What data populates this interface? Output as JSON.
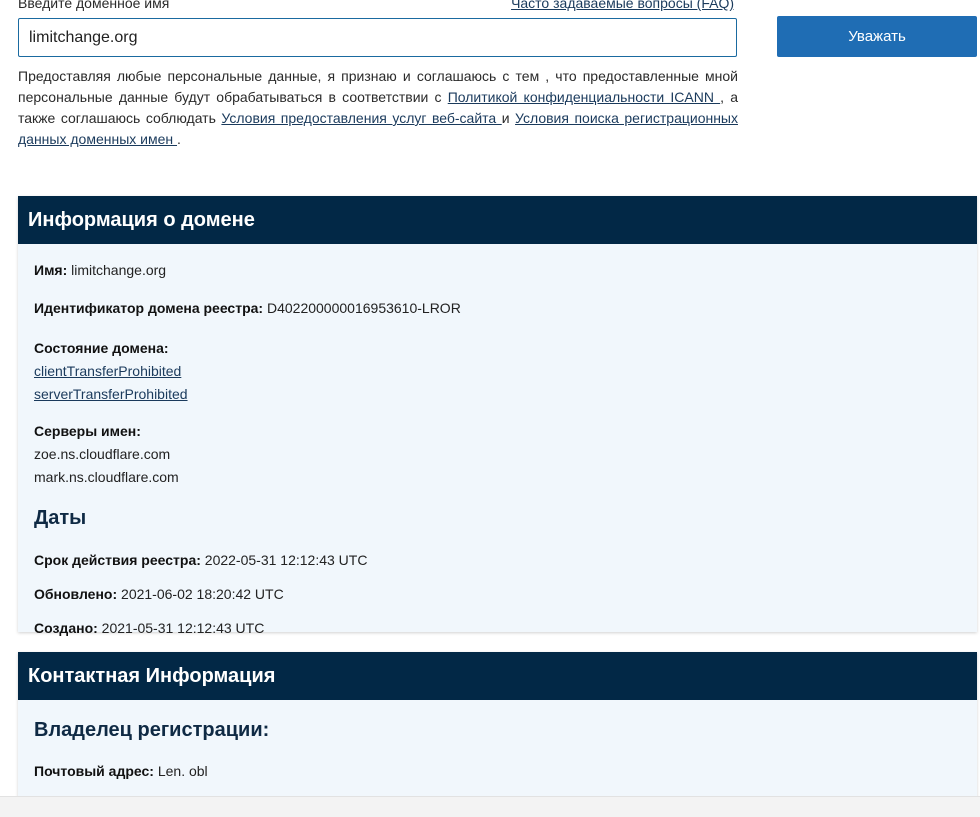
{
  "search": {
    "label": "Введите доменное имя",
    "faq_link": "Часто задаваемые вопросы (FAQ)",
    "value": "limitchange.org",
    "submit_label": "Уважать"
  },
  "consent": {
    "text1": "Предоставляя любые персональные данные, я признаю и соглашаюсь с тем , что предоставленные мной персональные данные будут обрабатываться в соответствии с ",
    "link1": "Политикой конфиденциальности ICANN ",
    "text2": ", а также соглашаюсь соблюдать ",
    "link2": "Условия предоставления услуг веб-сайта ",
    "text3": "и ",
    "link3": "Условия поиска регистрационных данных доменных имен ",
    "text4": "."
  },
  "domain_info": {
    "title": "Информация о домене",
    "name_label": "Имя:",
    "name_value": "limitchange.org",
    "registry_id_label": "Идентификатор домена реестра:",
    "registry_id_value": "D402200000016953610-LROR",
    "status_label": "Состояние домена:",
    "statuses": [
      "clientTransferProhibited",
      "serverTransferProhibited"
    ],
    "nameservers_label": "Серверы имен:",
    "nameservers": [
      "zoe.ns.cloudflare.com",
      "mark.ns.cloudflare.com"
    ],
    "dates_title": "Даты",
    "expiry_label": "Срок действия реестра:",
    "expiry_value": "2022-05-31 12:12:43 UTC",
    "updated_label": "Обновлено:",
    "updated_value": "2021-06-02 18:20:42 UTC",
    "created_label": "Создано:",
    "created_value": "2021-05-31 12:12:43 UTC"
  },
  "contact_info": {
    "title": "Контактная Информация",
    "registrant_title": "Владелец регистрации:",
    "address_label": "Почтовый адрес:",
    "address_value": "Len. obl"
  }
}
